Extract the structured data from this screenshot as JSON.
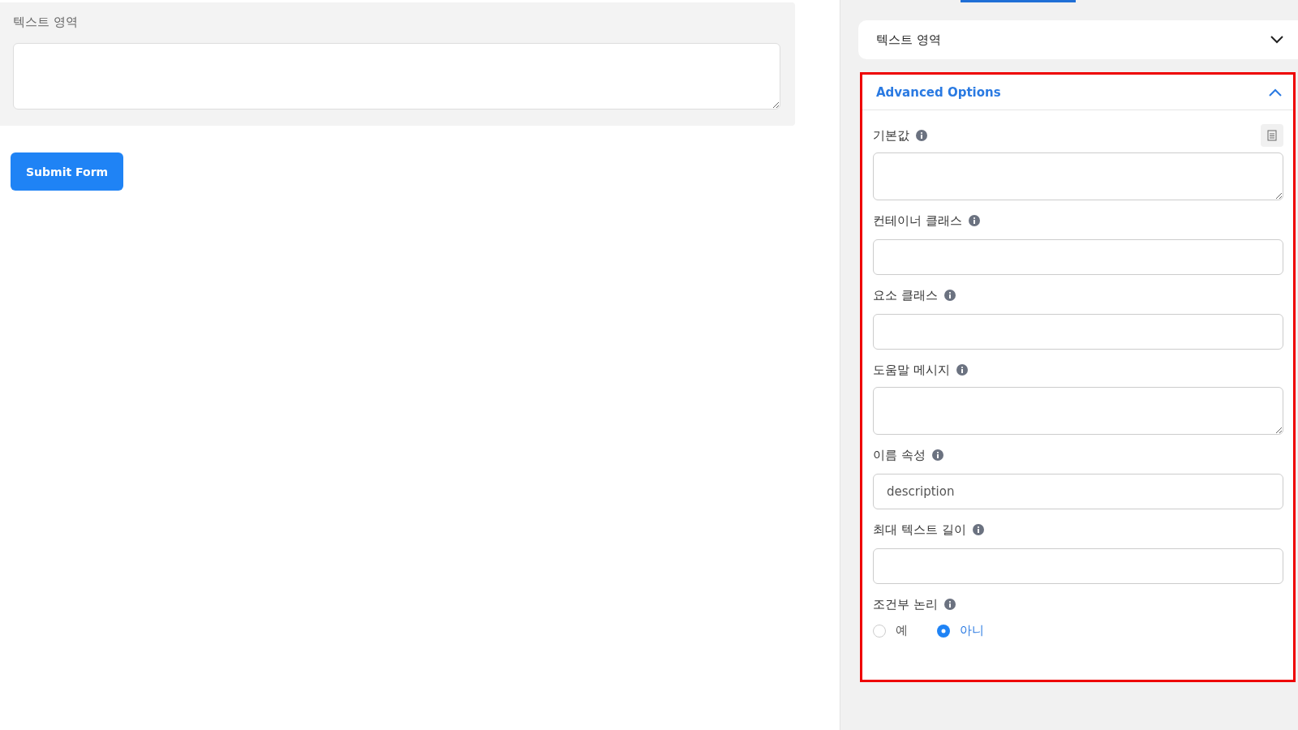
{
  "preview": {
    "label": "텍스트 영역",
    "submit": "Submit Form"
  },
  "sidebar": {
    "tab_indicator": true,
    "element_accordion": {
      "title": "텍스트 영역",
      "expanded": false
    },
    "advanced": {
      "title": "Advanced Options",
      "expanded": true,
      "fields": [
        {
          "kind": "textarea",
          "label": "기본값",
          "side_button": true
        },
        {
          "kind": "input",
          "label": "컨테이너 클래스"
        },
        {
          "kind": "input",
          "label": "요소 클래스"
        },
        {
          "kind": "textarea",
          "label": "도움말 메시지"
        },
        {
          "kind": "input",
          "label": "이름 속성",
          "value": "description"
        },
        {
          "kind": "input",
          "label": "최대 텍스트 길이"
        },
        {
          "kind": "radio",
          "label": "조건부 논리",
          "options": [
            {
              "label": "예",
              "selected": false
            },
            {
              "label": "아니",
              "selected": true
            }
          ]
        }
      ]
    }
  }
}
